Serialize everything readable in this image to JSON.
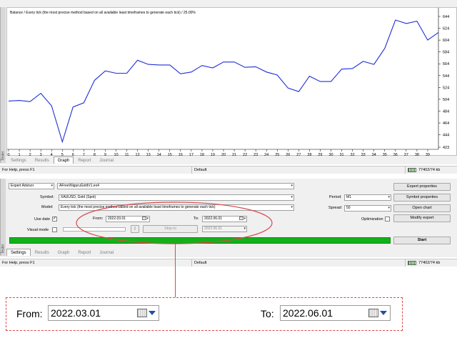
{
  "graph": {
    "title": "Balance / Every tick (the most precise method based on all available least timeframes to generate each tick) / 25.00%",
    "side_label": "Tester",
    "tabs": [
      "Settings",
      "Results",
      "Graph",
      "Report",
      "Journal"
    ],
    "active_tab": "Graph"
  },
  "chart_data": {
    "type": "line",
    "x": [
      0,
      1,
      2,
      3,
      4,
      5,
      6,
      7,
      8,
      9,
      10,
      11,
      12,
      13,
      14,
      15,
      16,
      17,
      18,
      19,
      20,
      21,
      22,
      23,
      24,
      25,
      26,
      27,
      28,
      29,
      30,
      31,
      32,
      33,
      34,
      35,
      36,
      37,
      38,
      39,
      40
    ],
    "values": [
      501,
      502,
      500,
      514,
      493,
      432,
      491,
      498,
      536,
      552,
      548,
      548,
      570,
      563,
      562,
      562,
      547,
      550,
      561,
      557,
      567,
      567,
      558,
      559,
      550,
      545,
      523,
      517,
      543,
      534,
      534,
      555,
      556,
      568,
      563,
      590,
      638,
      632,
      636,
      604,
      617
    ],
    "x_ticks": [
      "0",
      "1",
      "2",
      "3",
      "4",
      "5",
      "6",
      "7",
      "8",
      "9",
      "10",
      "11",
      "12",
      "13",
      "14",
      "15",
      "16",
      "17",
      "18",
      "19",
      "20",
      "21",
      "22",
      "23",
      "24",
      "25",
      "26",
      "27",
      "28",
      "29",
      "30",
      "31",
      "32",
      "33",
      "34",
      "35",
      "36",
      "37",
      "38",
      "39"
    ],
    "y_ticks": [
      "423",
      "444",
      "464",
      "484",
      "504",
      "524",
      "544",
      "564",
      "584",
      "604",
      "624",
      "644"
    ],
    "ylim": [
      423,
      644
    ],
    "line_color": "#1f2fd6",
    "grid": false
  },
  "status": {
    "help": "For Help, press F1",
    "profile": "Default",
    "memory": "77402/74 kb"
  },
  "settings": {
    "side_label": "Tester",
    "tabs": [
      "Settings",
      "Results",
      "Graph",
      "Report",
      "Journal"
    ],
    "active_tab": "Settings",
    "type_combo": "Expert Advisor",
    "ea_file": "AFree\\NiguruGoldV1.ex4",
    "symbol_label": "Symbol:",
    "symbol_value": "XAUUSD, Gold (Spot)",
    "model_label": "Model:",
    "model_value": "Every tick (the most precise method based on all available least timeframes to generate each tick)",
    "use_date_label": "Use date",
    "use_date_checked": "✓",
    "from_label": "From:",
    "from_value": "2022.03.01",
    "to_label": "To:",
    "to_value": "2022.06.01",
    "visual_mode_label": "Visual mode",
    "pause_label": "||",
    "skip_to_label": "Skip to",
    "skip_to_value": "2022.06.01",
    "period_label": "Period:",
    "period_value": "M1",
    "spread_label": "Spread:",
    "spread_value": "50",
    "optimization_label": "Optimization",
    "btn_expert_properties": "Expert properties",
    "btn_symbol_properties": "Symbol properties",
    "btn_open_chart": "Open chart",
    "btn_modify_expert": "Modify expert",
    "btn_start": "Start"
  },
  "zoom": {
    "from_label": "From:",
    "from_value": "2022.03.01",
    "to_label": "To:",
    "to_value": "2022.06.01",
    "highlight_color": "#d9494a"
  }
}
